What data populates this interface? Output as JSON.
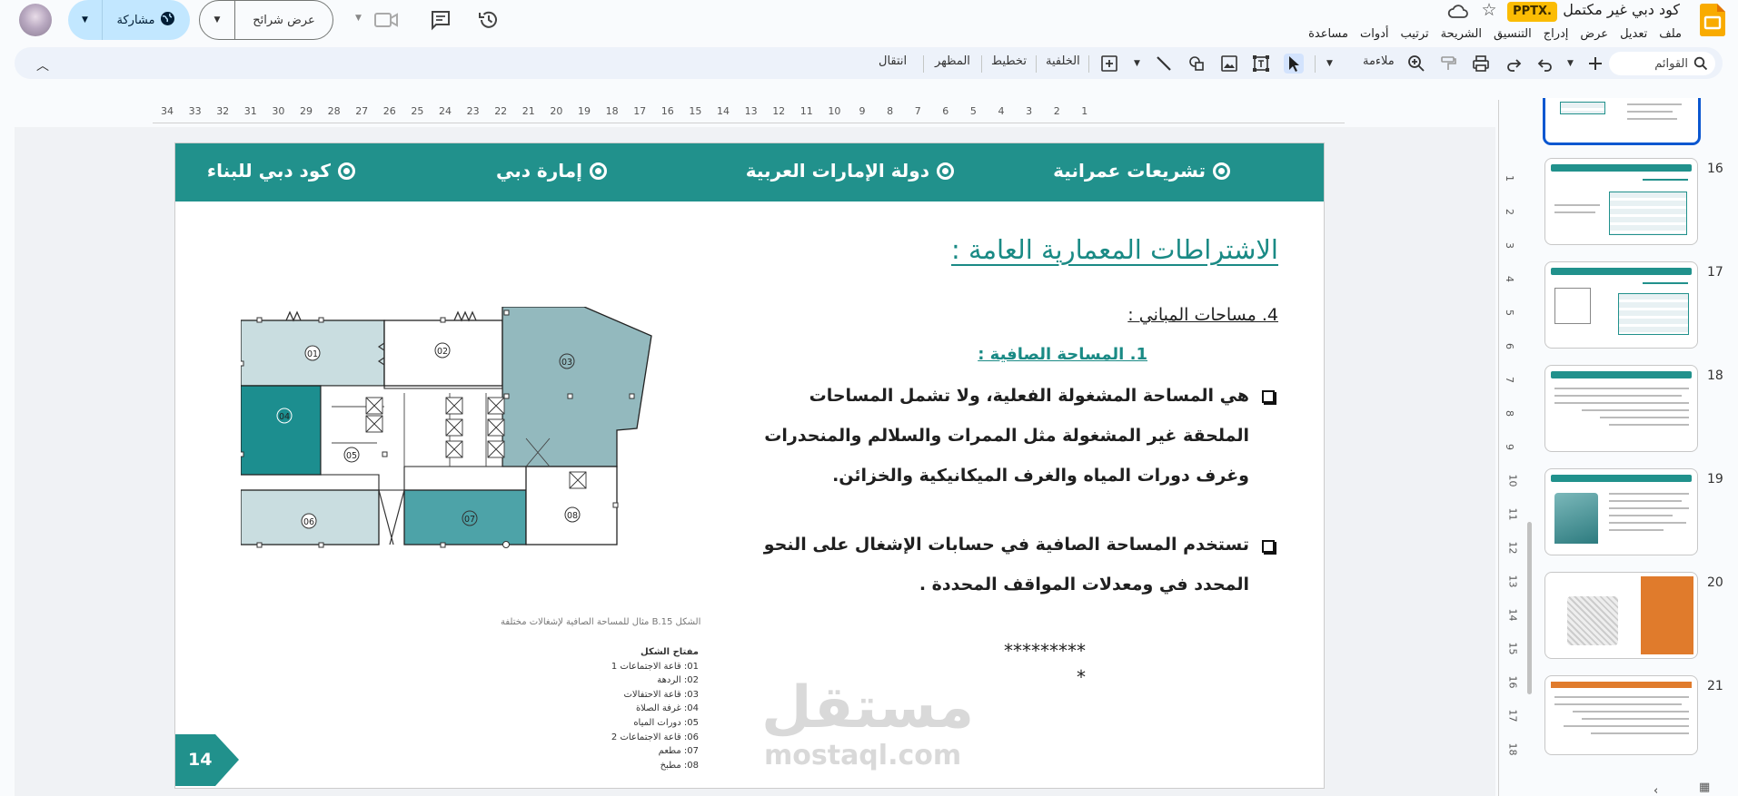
{
  "doc": {
    "title": "كود دبي غير مكتمل",
    "format_badge": "PPTX."
  },
  "menu": [
    "ملف",
    "تعديل",
    "عرض",
    "إدراج",
    "التنسيق",
    "الشريحة",
    "ترتيب",
    "أدوات",
    "مساعدة"
  ],
  "header_actions": {
    "slideshow_label": "عرض شرائح",
    "share_label": "مشاركة"
  },
  "toolbar": {
    "search_placeholder": "القوائم",
    "zoom_label": "ملاءمة",
    "text_items": [
      "الخلفية",
      "تخطيط",
      "المظهر",
      "انتقال"
    ]
  },
  "ruler": {
    "ticks": [
      "34",
      "33",
      "32",
      "31",
      "30",
      "29",
      "28",
      "27",
      "26",
      "25",
      "24",
      "23",
      "22",
      "21",
      "20",
      "19",
      "18",
      "17",
      "16",
      "15",
      "14",
      "13",
      "12",
      "11",
      "10",
      "9",
      "8",
      "7",
      "6",
      "5",
      "4",
      "3",
      "2",
      "1"
    ]
  },
  "vruler": {
    "ticks": [
      "1",
      "2",
      "3",
      "4",
      "5",
      "6",
      "7",
      "8",
      "9",
      "10",
      "11",
      "12",
      "13",
      "14",
      "15",
      "16",
      "17",
      "18"
    ]
  },
  "slide": {
    "header": [
      "تشريعات عمرانية",
      "دولة الإمارات العربية",
      "إمارة دبي",
      "كود دبي للبناء"
    ],
    "heading": "الاشتراطات المعمارية العامة :",
    "sub_heading": "4. مساحات المباني :",
    "subsub_heading": "1. المساحة الصافية :",
    "para1": "هي المساحة المشغولة الفعلية، ولا تشمل المساحات الملحقة غير المشغولة مثل الممرات والسلالم والمنحدرات وغرف دورات المياه والغرف الميكانيكية والخزائن.",
    "para2": "تستخدم المساحة الصافية في حسابات الإشغال على النحو المحدد في ومعدلات المواقف المحددة .",
    "stars1": "*********",
    "stars2": "*",
    "fig_caption": "الشكل B.15   مثال للمساحة الصافية لإشغالات مختلفة",
    "legend_title": "مفتاح الشكل",
    "legend": [
      "01: قاعة الاجتماعات 1",
      "02: الردهة",
      "03: قاعة الاحتفالات",
      "04: غرفة الصلاة",
      "05: دورات المياه",
      "06: قاعة الاجتماعات 2",
      "07: مطعم",
      "08: مطبخ"
    ],
    "room_labels": [
      "01",
      "02",
      "03",
      "04",
      "05",
      "06",
      "07",
      "08"
    ],
    "page_number": "14",
    "watermark_ar": "مستقل",
    "watermark_en": "mostaql.com"
  },
  "filmstrip": {
    "numbers": [
      "16",
      "17",
      "18",
      "19",
      "20",
      "21"
    ]
  },
  "colors": {
    "teal": "#21918c",
    "teal_light": "#c9dde0",
    "teal_mid": "#93b9be",
    "teal_dark": "#1c8e8f",
    "share_bg": "#c2e7ff",
    "badge": "#fbbc04"
  }
}
